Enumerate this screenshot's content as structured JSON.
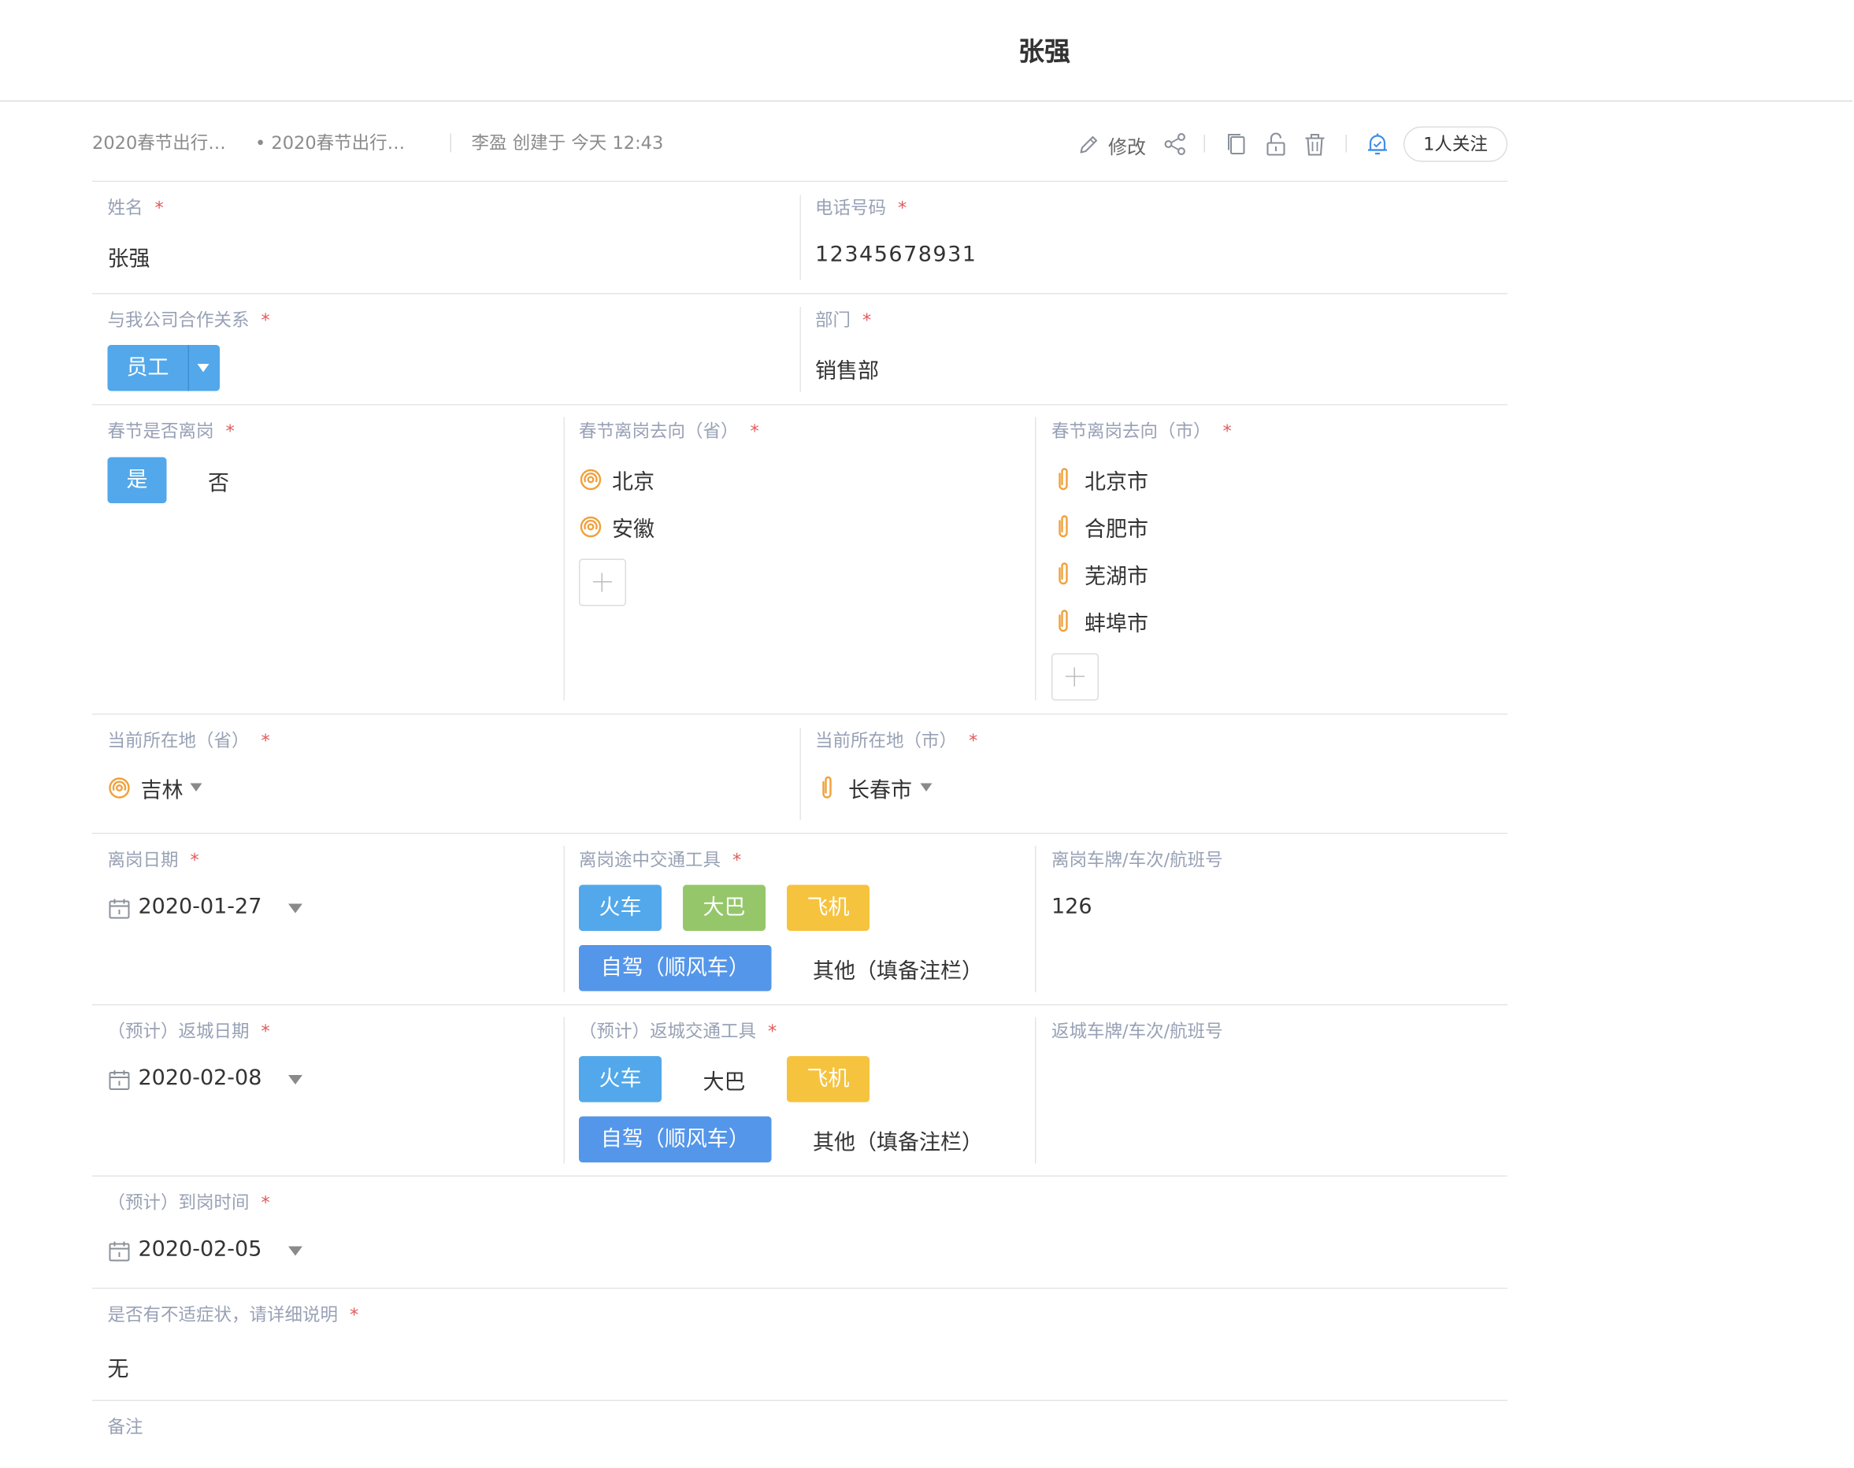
{
  "header": {
    "title": "张强"
  },
  "meta": {
    "breadcrumb_1": "2020春节出行…",
    "breadcrumb_2": "• 2020春节出行…",
    "creator": "李盈  创建于  今天 12:43"
  },
  "toolbar": {
    "edit_label": "修改",
    "follow_label": "1人关注"
  },
  "fields": {
    "name": {
      "label": "姓名",
      "value": "张强"
    },
    "phone": {
      "label": "电话号码",
      "value": "12345678931"
    },
    "relation": {
      "label": "与我公司合作关系",
      "value": "员工"
    },
    "department": {
      "label": "部门",
      "value": "销售部"
    },
    "leave_during_festival": {
      "label": "春节是否离岗",
      "options": [
        "是",
        "否"
      ],
      "selected": "是"
    },
    "destination_province": {
      "label": "春节离岗去向（省）",
      "values": [
        "北京",
        "安徽"
      ]
    },
    "destination_city": {
      "label": "春节离岗去向（市）",
      "values": [
        "北京市",
        "合肥市",
        "芜湖市",
        "蚌埠市"
      ]
    },
    "current_province": {
      "label": "当前所在地（省）",
      "value": "吉林"
    },
    "current_city": {
      "label": "当前所在地（市）",
      "value": "长春市"
    },
    "leave_date": {
      "label": "离岗日期",
      "value": "2020-01-27"
    },
    "leave_transport": {
      "label": "离岗途中交通工具",
      "options": [
        "火车",
        "大巴",
        "飞机",
        "自驾（顺风车）",
        "其他（填备注栏）"
      ],
      "selected": [
        "火车",
        "大巴",
        "飞机",
        "自驾（顺风车）"
      ]
    },
    "leave_plate": {
      "label": "离岗车牌/车次/航班号",
      "value": "126"
    },
    "return_date": {
      "label": "（预计）返城日期",
      "value": "2020-02-08"
    },
    "return_transport": {
      "label": "（预计）返城交通工具",
      "options": [
        "火车",
        "大巴",
        "飞机",
        "自驾（顺风车）",
        "其他（填备注栏）"
      ],
      "selected": [
        "火车",
        "飞机",
        "自驾（顺风车）"
      ]
    },
    "return_plate": {
      "label": "返城车牌/车次/航班号",
      "value": ""
    },
    "arrival_time": {
      "label": "（预计）到岗时间",
      "value": "2020-02-05"
    },
    "symptoms": {
      "label": "是否有不适症状，请详细说明",
      "value": "无"
    },
    "remarks": {
      "label": "备注",
      "value": ""
    }
  },
  "colors": {
    "blue": "#52a8ea",
    "green": "#95c76a",
    "yellow": "#f6c33f",
    "dark_blue": "#5496ea",
    "required": "#e25a5a",
    "label": "#98a1b5"
  },
  "icons": [
    "edit-icon",
    "share-icon",
    "copy-icon",
    "unlock-icon",
    "delete-icon",
    "bell-icon",
    "location-icon",
    "paperclip-icon",
    "calendar-icon",
    "chevron-down-icon",
    "plus-icon"
  ]
}
